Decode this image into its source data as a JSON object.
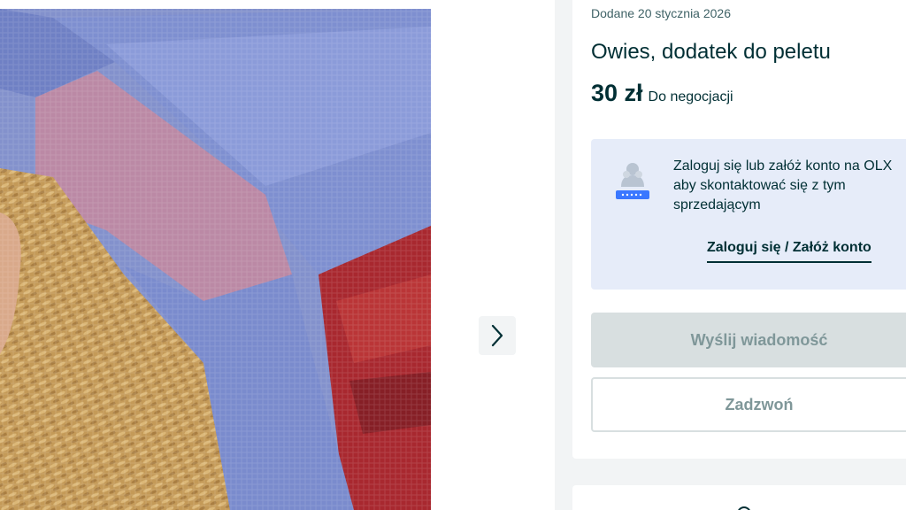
{
  "listing": {
    "posted_date": "Dodane 20 stycznia 2026",
    "title": "Owies, dodatek do peletu",
    "price": "30 zł",
    "price_note": "Do negocjacji"
  },
  "gallery": {
    "next_icon": "chevron-right-icon"
  },
  "contact": {
    "login_prompt": "Zaloguj się lub załóż konto na OLX\naby skontaktować się z tym\nsprzedającym",
    "login_link": "Zaloguj się / Załóż konto",
    "message_button": "Wyślij wiadomość",
    "call_button": "Zadzwoń"
  },
  "colors": {
    "text_primary": "#002f34",
    "login_box_bg": "#e6ecf9",
    "disabled_button_bg": "#d8dfe0",
    "disabled_button_text": "#7f9799"
  }
}
